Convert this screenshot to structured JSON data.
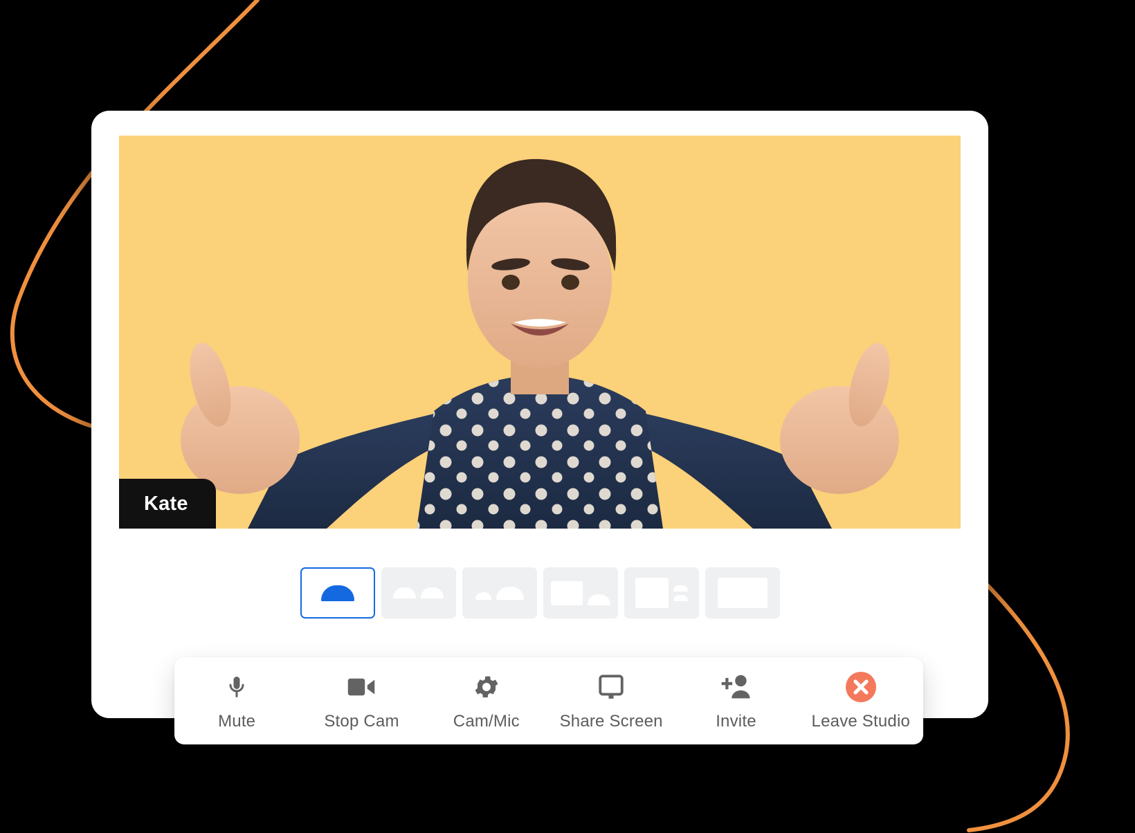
{
  "colors": {
    "background": "#000000",
    "window": "#ffffff",
    "video_backdrop": "#fbd179",
    "accent_blue": "#1569e0",
    "accent_orange": "#f0903e",
    "leave_red": "#f4785c",
    "badge_black": "#111111",
    "layout_idle": "#eff0f2",
    "label_text": "#5c5c5c"
  },
  "video": {
    "participant_name": "Kate",
    "backdrop_color": "#fbd179",
    "subject": "smiling woman with dark hair wearing navy polka-dot shirt, hands raised"
  },
  "layout_selector": {
    "selected_index": 0,
    "options": [
      {
        "name": "layout-single-speaker",
        "icon": "single-person-icon",
        "selected": true
      },
      {
        "name": "layout-two-up",
        "icon": "two-people-icon",
        "selected": false
      },
      {
        "name": "layout-small-large",
        "icon": "small-large-people-icon",
        "selected": false
      },
      {
        "name": "layout-screen-person",
        "icon": "screen-and-person-icon",
        "selected": false
      },
      {
        "name": "layout-screen-sidebar",
        "icon": "screen-and-sidebar-people-icon",
        "selected": false
      },
      {
        "name": "layout-fullscreen",
        "icon": "fullscreen-screen-icon",
        "selected": false
      }
    ]
  },
  "controls": [
    {
      "label": "Mute",
      "icon": "microphone-icon",
      "name": "mute-button"
    },
    {
      "label": "Stop Cam",
      "icon": "video-camera-icon",
      "name": "stop-cam-button"
    },
    {
      "label": "Cam/Mic",
      "icon": "gear-icon",
      "name": "cam-mic-settings-button"
    },
    {
      "label": "Share Screen",
      "icon": "monitor-icon",
      "name": "share-screen-button"
    },
    {
      "label": "Invite",
      "icon": "person-plus-icon",
      "name": "invite-button"
    },
    {
      "label": "Leave Studio",
      "icon": "close-circle-icon",
      "name": "leave-studio-button"
    }
  ]
}
